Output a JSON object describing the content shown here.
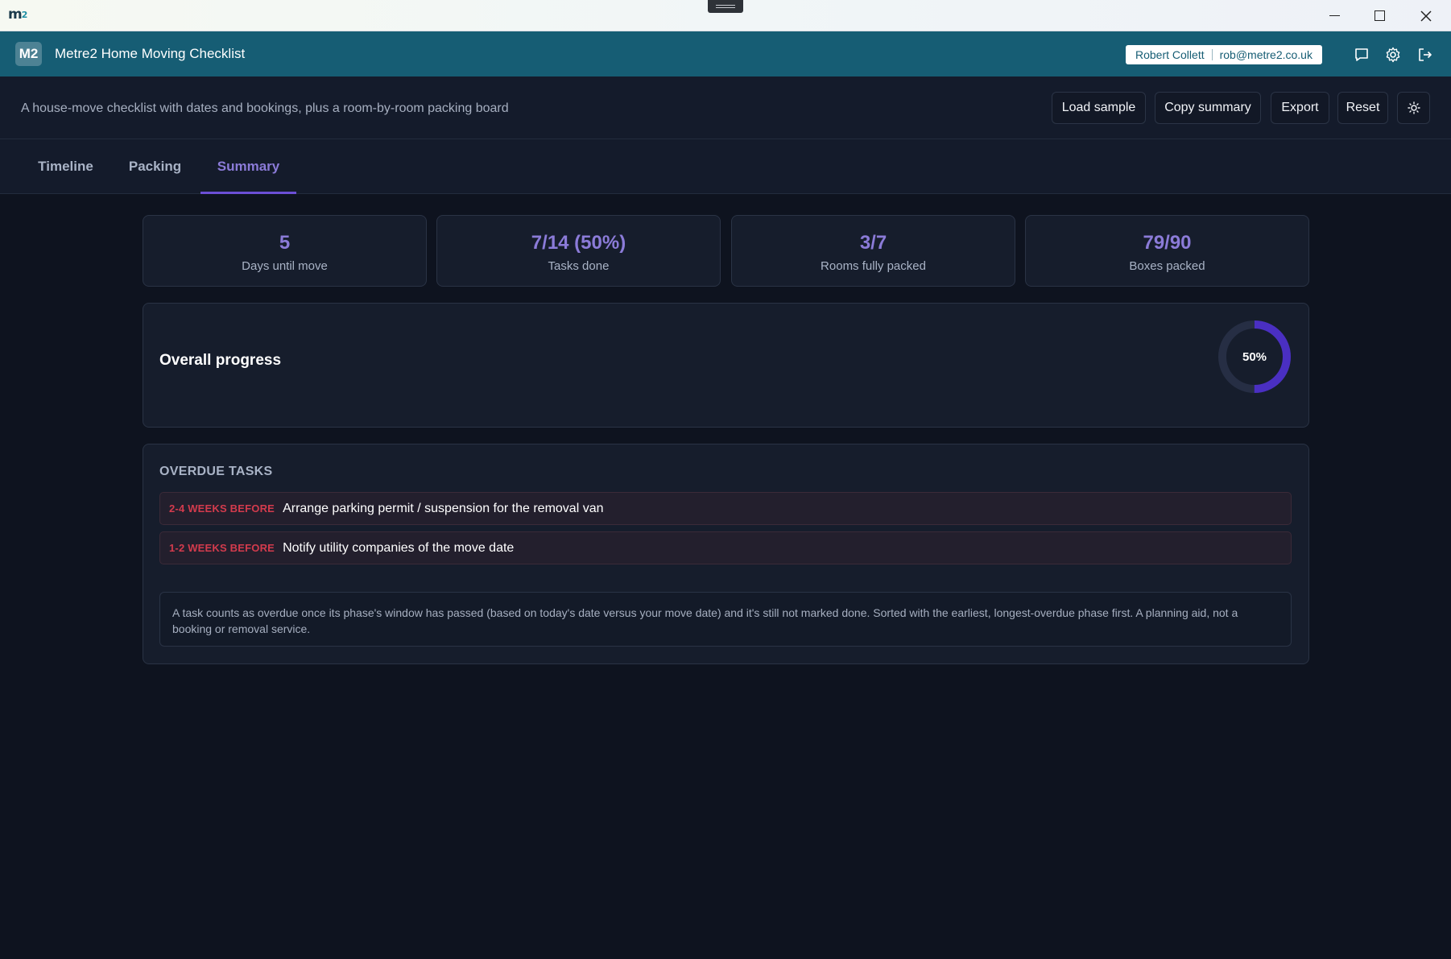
{
  "os": {
    "logo_main": "m",
    "logo_sub": "2"
  },
  "header": {
    "badge": "M2",
    "title": "Metre2 Home Moving Checklist",
    "user_name": "Robert Collett",
    "user_email": "rob@metre2.co.uk",
    "icons": [
      "chat-icon",
      "gear-icon",
      "logout-icon"
    ]
  },
  "toolbar": {
    "tagline": "A house-move checklist with dates and bookings, plus a room-by-room packing board",
    "load_sample": "Load sample",
    "copy_summary": "Copy summary",
    "export": "Export",
    "reset": "Reset",
    "theme_icon": "sun-icon"
  },
  "tabs": [
    {
      "label": "Timeline",
      "active": false
    },
    {
      "label": "Packing",
      "active": false
    },
    {
      "label": "Summary",
      "active": true
    }
  ],
  "stats": [
    {
      "value": "5",
      "label": "Days until move"
    },
    {
      "value": "7/14 (50%)",
      "label": "Tasks done"
    },
    {
      "value": "3/7",
      "label": "Rooms fully packed"
    },
    {
      "value": "79/90",
      "label": "Boxes packed"
    }
  ],
  "progress": {
    "title": "Overall progress",
    "percent": 50,
    "label": "50%"
  },
  "overdue": {
    "heading": "OVERDUE TASKS",
    "items": [
      {
        "phase": "2-4 WEEKS BEFORE",
        "task": "Arrange parking permit / suspension for the removal van"
      },
      {
        "phase": "1-2 WEEKS BEFORE",
        "task": "Notify utility companies of the move date"
      }
    ],
    "note": "A task counts as overdue once its phase's window has passed (based on today's date versus your move date) and it's still not marked done. Sorted with the earliest, longest-overdue phase first. A planning aid, not a booking or removal service."
  },
  "colors": {
    "accent": "#8b7bd8",
    "tab_underline": "#6c4fd6",
    "header_bg": "#165d74",
    "overdue_red": "#d33b4d",
    "ring_fill": "#4a2fc2",
    "ring_track": "#262e44"
  }
}
